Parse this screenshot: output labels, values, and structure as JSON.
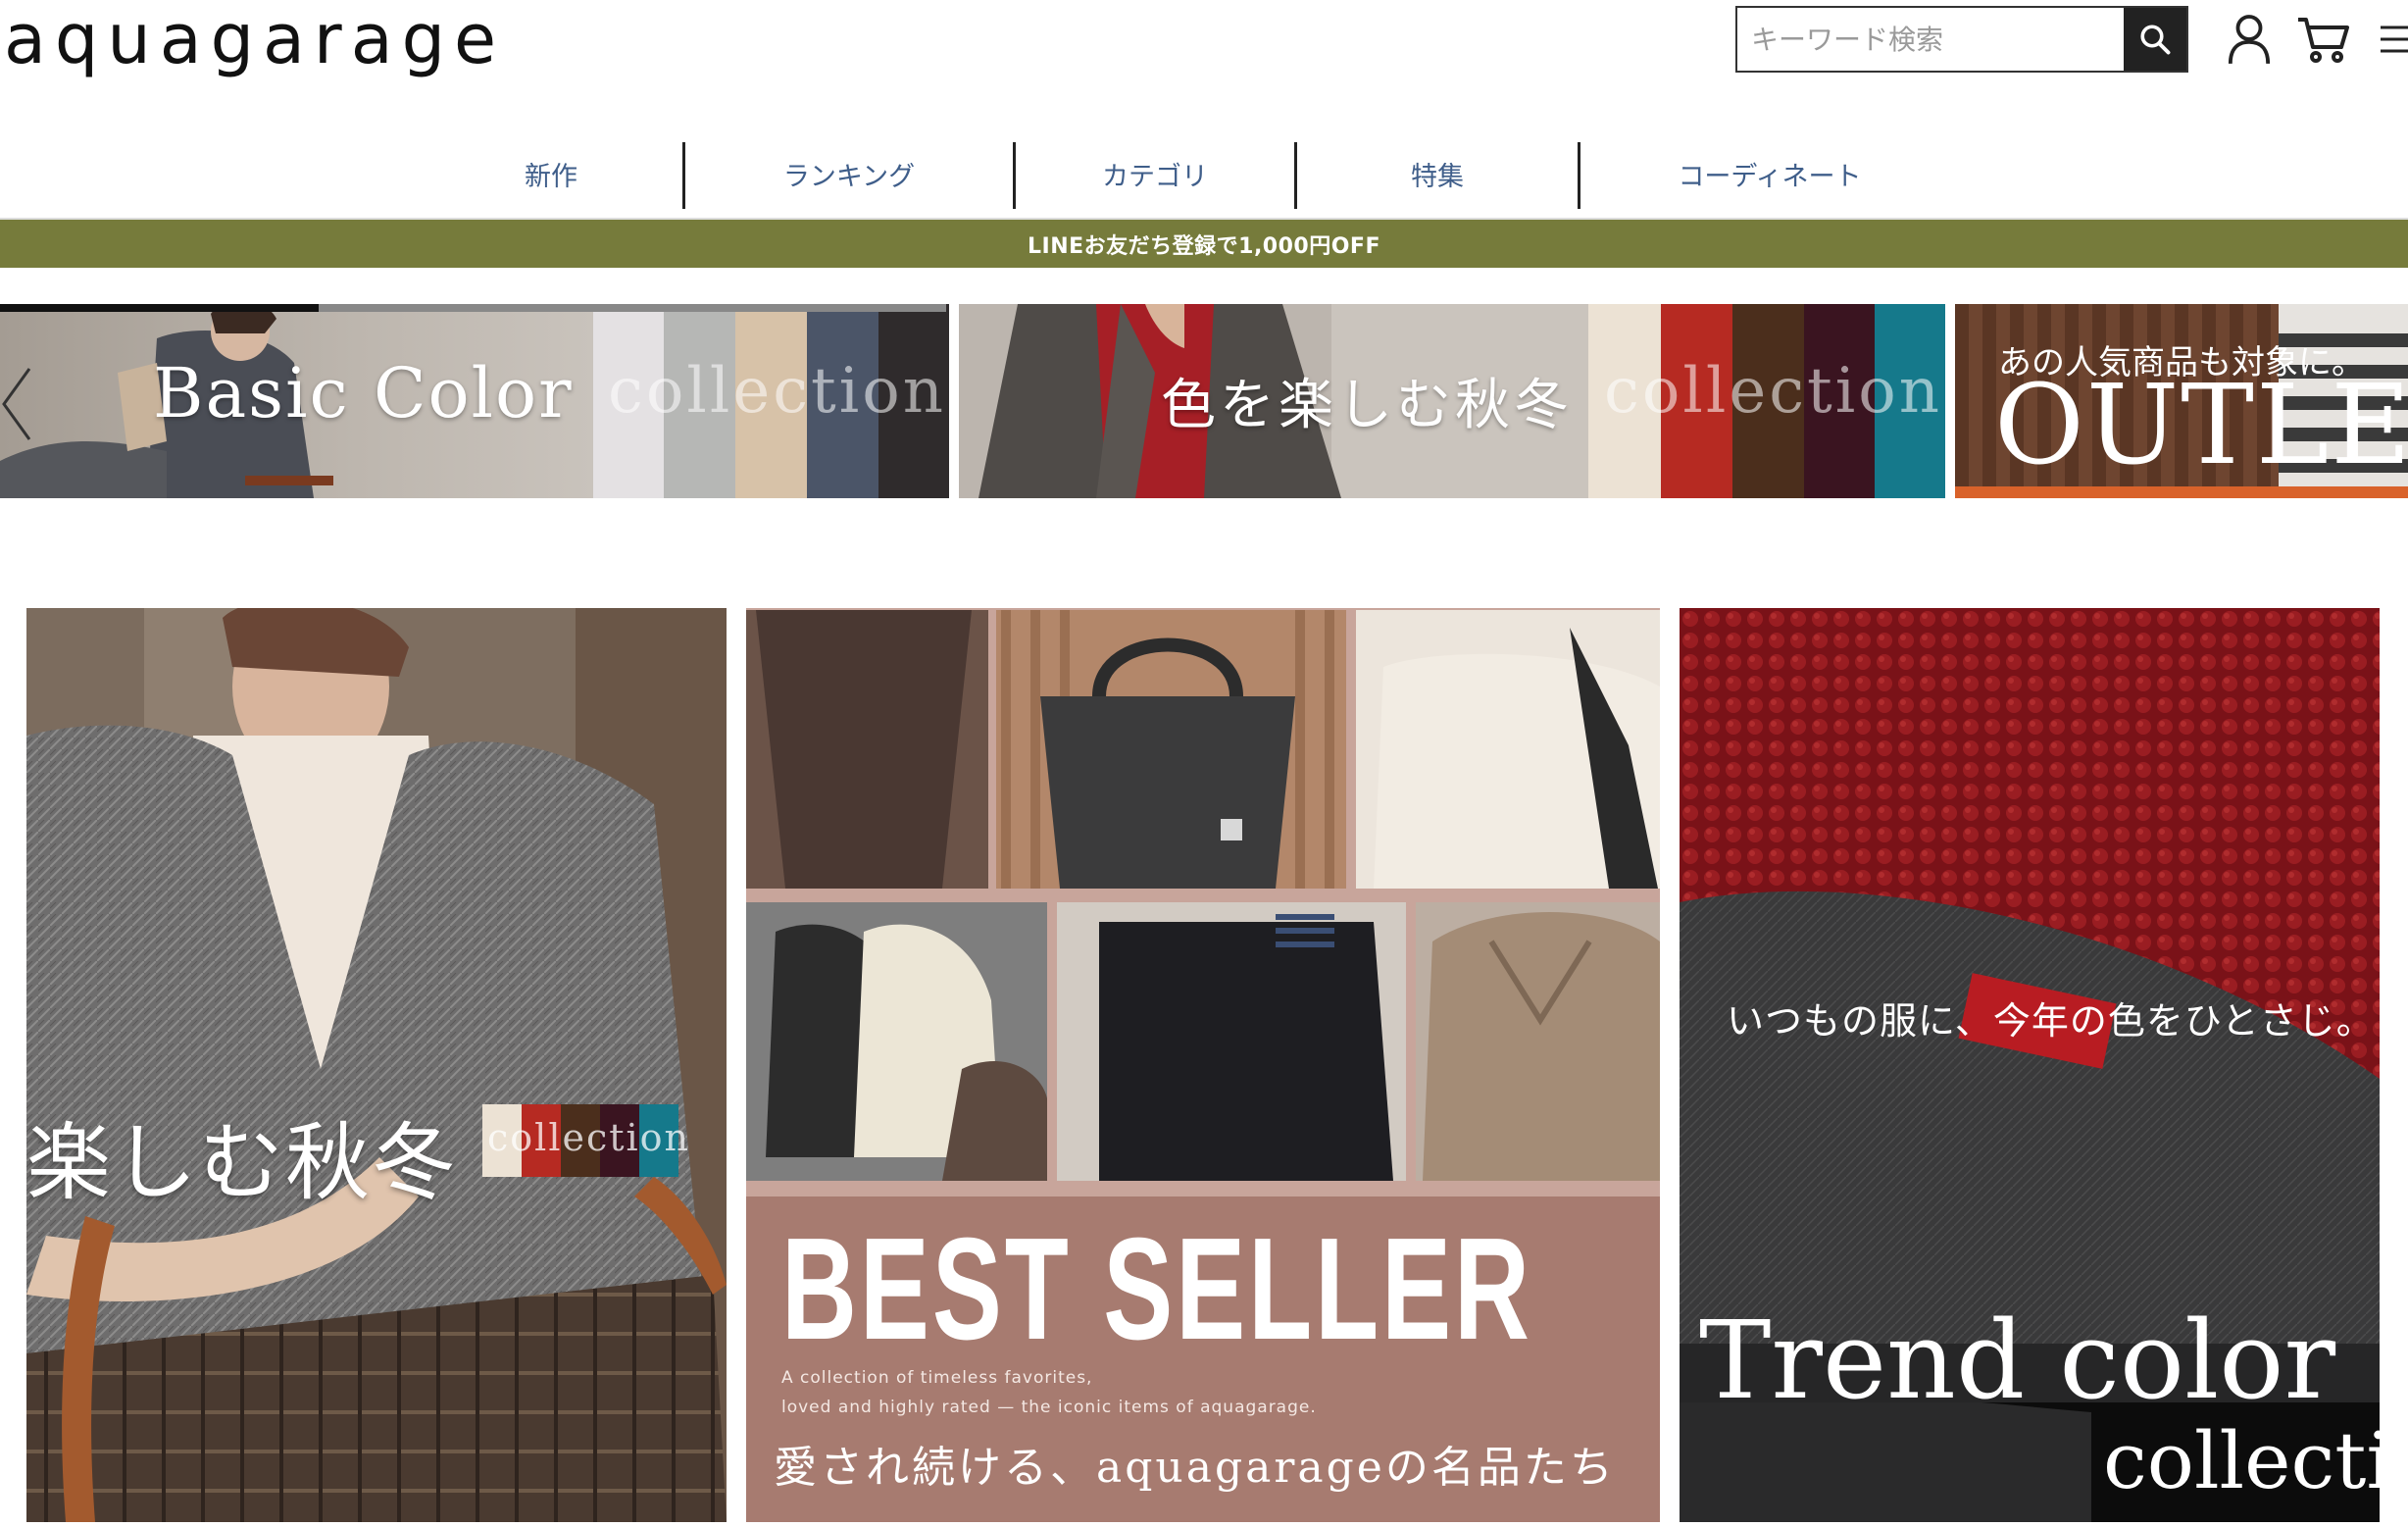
{
  "header": {
    "logo": "aquagarage",
    "search_placeholder": "キーワード検索"
  },
  "nav": [
    {
      "label": "新作"
    },
    {
      "label": "ランキング"
    },
    {
      "label": "カテゴリ"
    },
    {
      "label": "特集"
    },
    {
      "label": "コーディネート"
    }
  ],
  "promo_text": "LINEお友だち登録で1,000円OFF",
  "carousel": {
    "slide1": {
      "title": "Basic Color",
      "sub": "collection",
      "swatches": [
        "#e4e1e3",
        "#b6b7b5",
        "#d7c2a8",
        "#4b5568",
        "#2f2b2c"
      ]
    },
    "slide2": {
      "title": "色を楽しむ秋冬",
      "sub": "collection",
      "swatches": [
        "#ece2d4",
        "#b62a22",
        "#4b2e1c",
        "#3a1420",
        "#15798b"
      ]
    },
    "slide3": {
      "kicker": "あの人気商品も対象に。",
      "title": "OUTLE"
    }
  },
  "banners": {
    "left": {
      "title": "楽しむ秋冬",
      "sub": "collection"
    },
    "center": {
      "title": "BEST SELLER",
      "line1": "A collection of timeless favorites,",
      "line2": "loved and highly rated — the iconic items of aquagarage.",
      "jp": "愛され続ける、aquagarageの名品たち"
    },
    "right": {
      "tag_pre": "いつもの服に、",
      "tag_hl": "今年の色",
      "tag_post": "をひとさじ。",
      "title": "Trend color",
      "sub": "collectio"
    }
  },
  "colors": {
    "promo": "#767b3b",
    "nav_text": "#3f5e8a",
    "best_seller_bg": "#a77b70"
  }
}
